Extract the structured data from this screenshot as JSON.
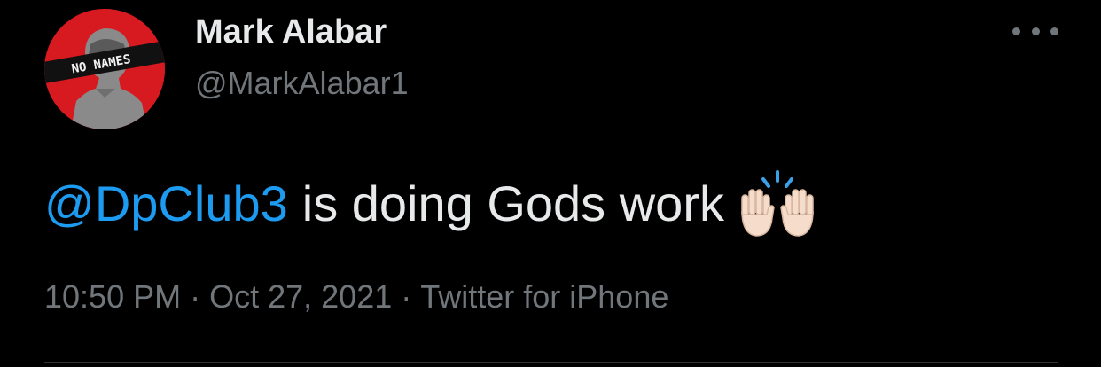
{
  "author": {
    "display_name": "Mark Alabar",
    "handle": "@MarkAlabar1",
    "avatar_text": "NO NAMES"
  },
  "tweet": {
    "mention": "@DpClub3",
    "text": "is doing Gods work",
    "emoji_icon": "raising-hands-icon"
  },
  "meta": {
    "time": "10:50 PM",
    "separator": "·",
    "date": "Oct 27, 2021",
    "source": "Twitter for iPhone"
  },
  "colors": {
    "background": "#000000",
    "primary_text": "#e7e9ea",
    "secondary_text": "#71767b",
    "link": "#1d9bf0",
    "avatar_red": "#d71920"
  }
}
